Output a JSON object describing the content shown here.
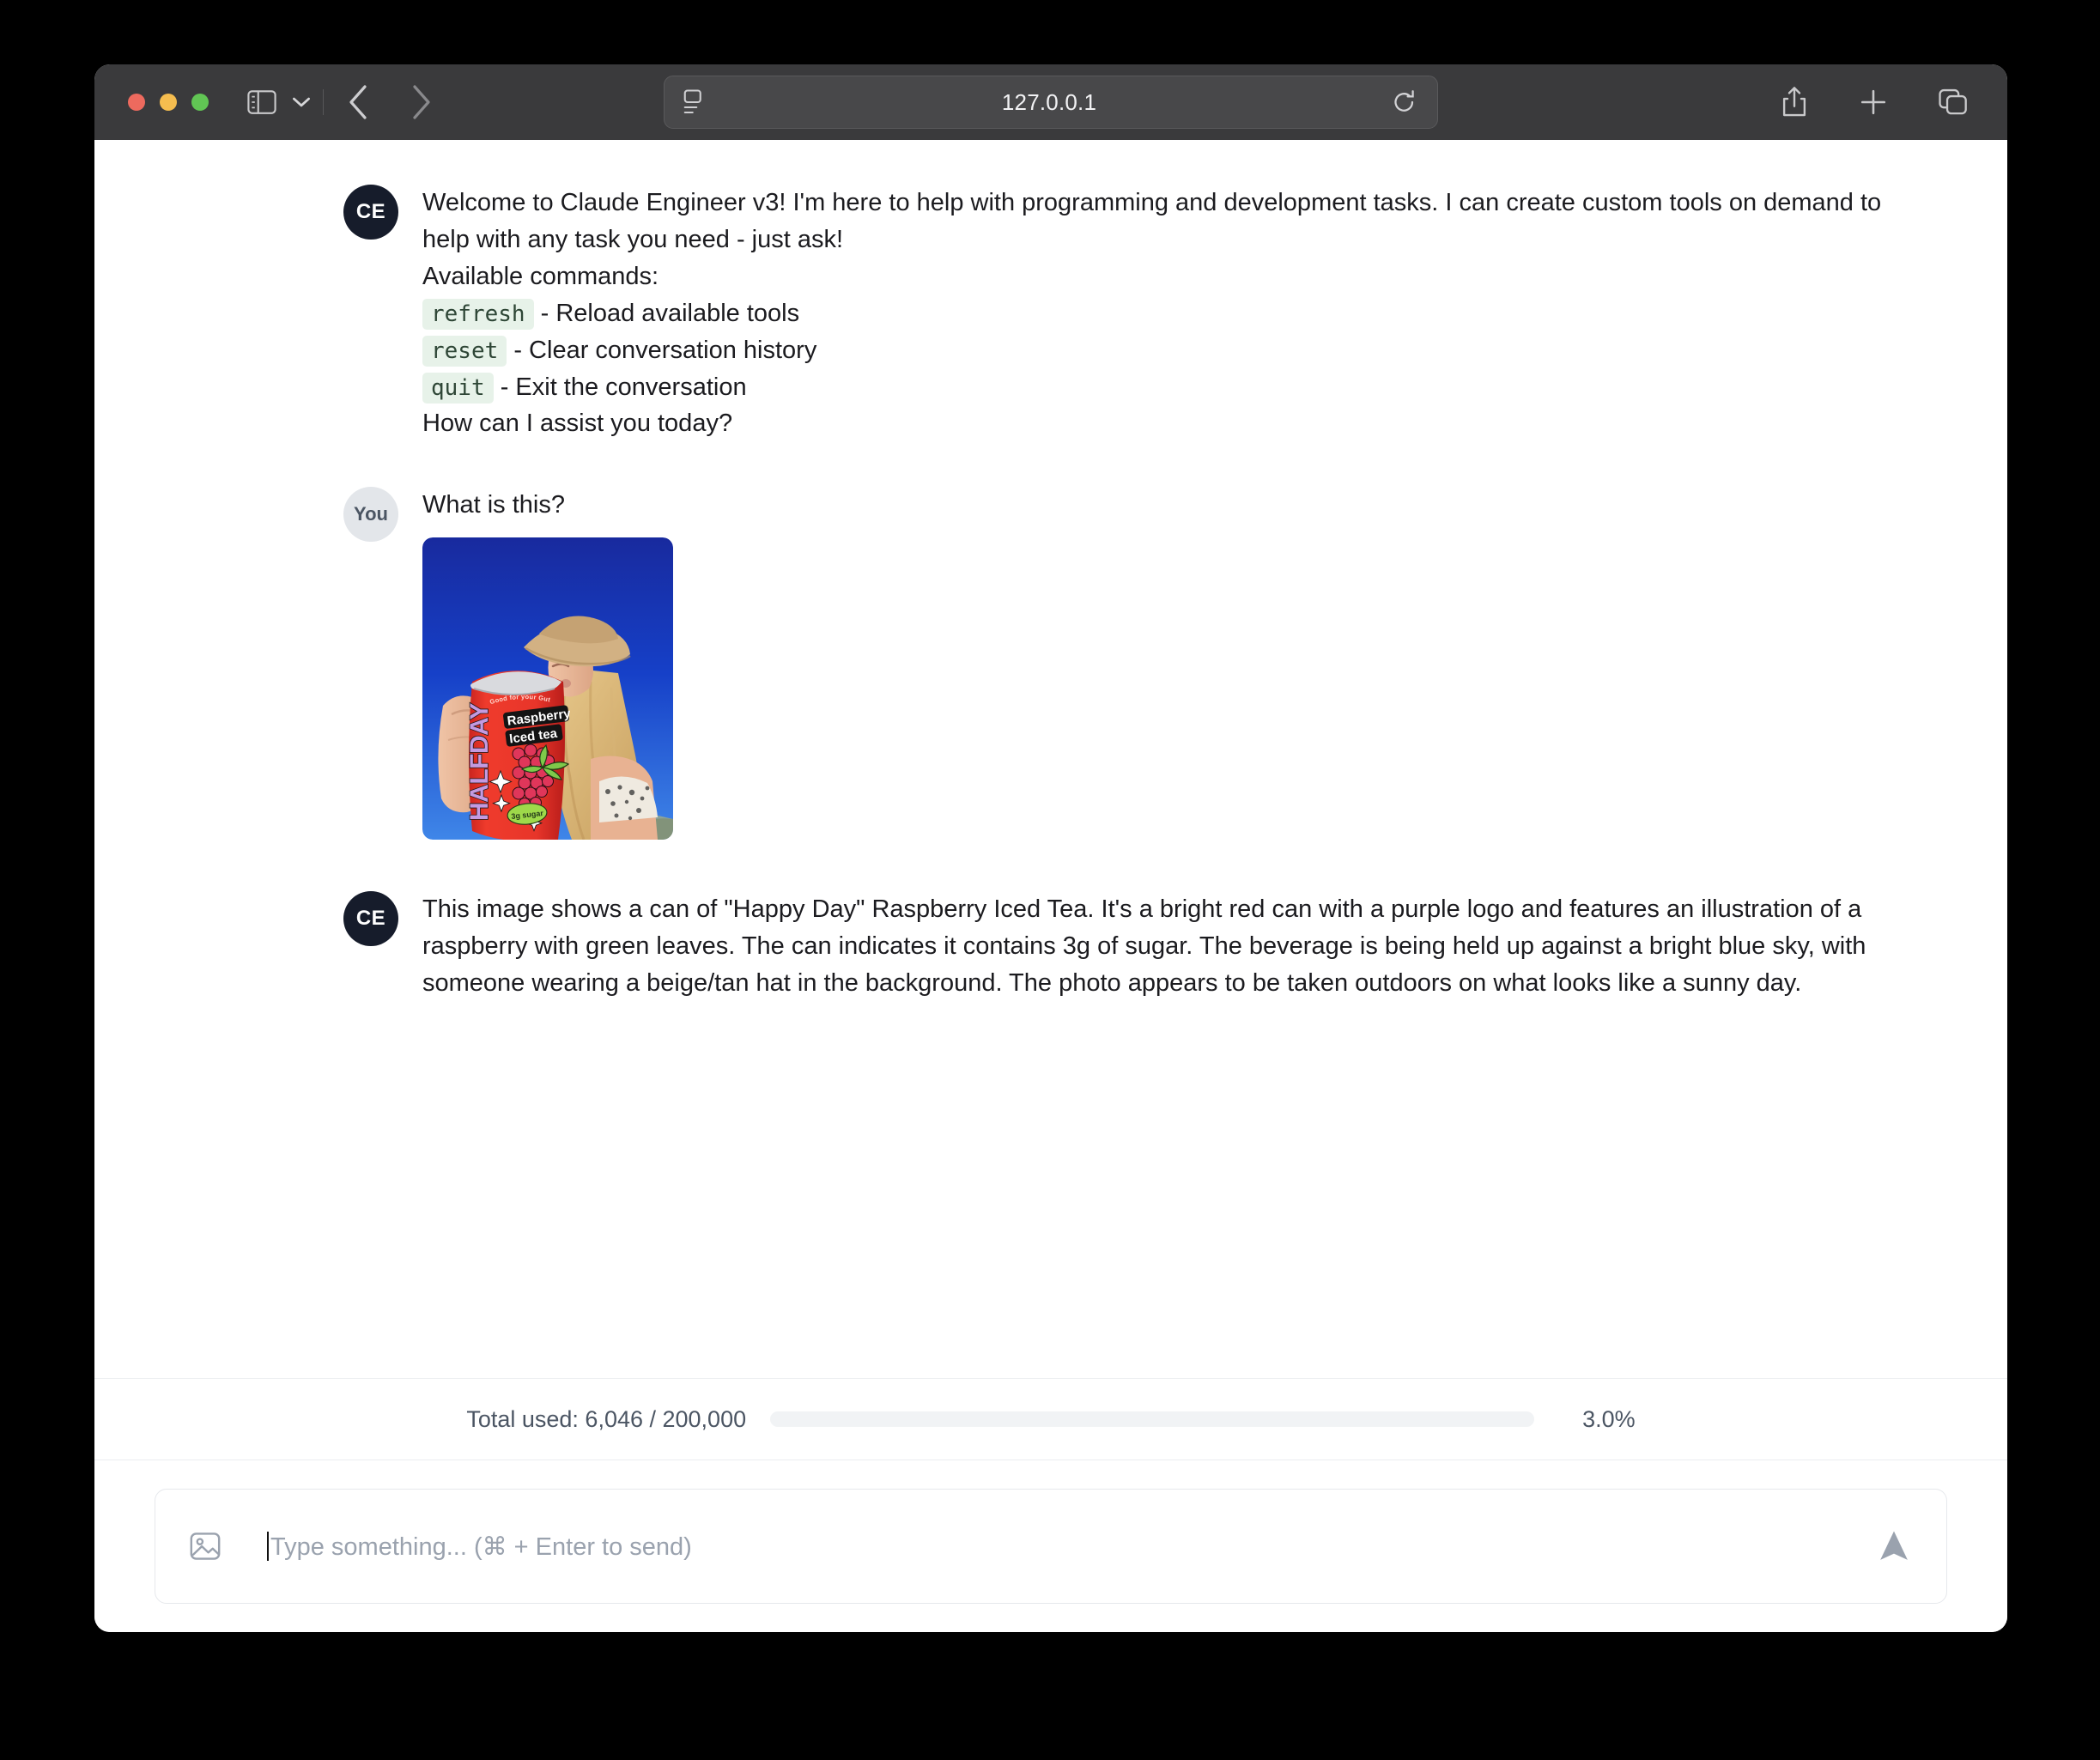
{
  "browser": {
    "url": "127.0.0.1",
    "traffic_lights": [
      "close-red",
      "minimize-yellow",
      "maximize-green"
    ],
    "icons": {
      "sidebar": "sidebar-toggle-icon",
      "chevron": "chevron-down-icon",
      "back": "back-arrow-icon",
      "forward": "forward-arrow-icon",
      "reader": "reader-view-icon",
      "reload": "reload-icon",
      "share": "share-icon",
      "new_tab": "plus-icon",
      "tab_overview": "tab-overview-icon"
    }
  },
  "chat": {
    "messages": [
      {
        "author": "CE",
        "avatar_label": "CE",
        "lines": [
          "Welcome to Claude Engineer v3! I'm here to help with programming and development tasks. I can create custom tools on demand to help with any task you need - just ask!",
          "Available commands:"
        ],
        "commands": [
          {
            "cmd": "refresh",
            "desc": "- Reload available tools"
          },
          {
            "cmd": "reset",
            "desc": "- Clear conversation history"
          },
          {
            "cmd": "quit",
            "desc": "- Exit the conversation"
          }
        ],
        "closing": "How can I assist you today?"
      },
      {
        "author": "You",
        "avatar_label": "You",
        "text": "What is this?",
        "image": {
          "alt": "Photo of a hand holding a HALFDAY Raspberry Iced Tea can against a blue sky, a woman in a tan cowboy hat behind it",
          "can_brand": "HALFDAY",
          "can_flavor_line1": "Raspberry",
          "can_flavor_line2": "Iced tea",
          "can_top_text": "Good for your Gut",
          "can_badge": "3g sugar"
        }
      },
      {
        "author": "CE",
        "avatar_label": "CE",
        "text": "This image shows a can of \"Happy Day\" Raspberry Iced Tea. It's a bright red can with a purple logo and features an illustration of a raspberry with green leaves. The can indicates it contains 3g of sugar. The beverage is being held up against a bright blue sky, with someone wearing a beige/tan hat in the background. The photo appears to be taken outdoors on what looks like a sunny day."
      }
    ]
  },
  "status": {
    "usage_label": "Total used: 6,046 / 200,000",
    "percent_label": "3.0%",
    "percent_value": 3.0,
    "progress_color": "#4caf87",
    "track_color": "#f1f3f5"
  },
  "composer": {
    "placeholder": "Type something... (⌘ + Enter to send)",
    "attach_icon": "image-attach-icon",
    "send_icon": "send-arrow-icon"
  }
}
